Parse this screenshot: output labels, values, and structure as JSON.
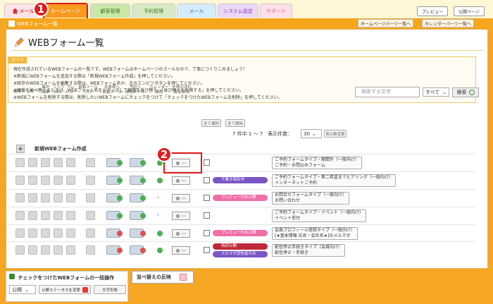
{
  "tabs": [
    {
      "label": "メール"
    },
    {
      "label": "ホームページ"
    },
    {
      "label": "顧客管理"
    },
    {
      "label": "予約管理"
    },
    {
      "label": "メール"
    },
    {
      "label": "システム設定"
    },
    {
      "label": "サポート"
    }
  ],
  "top_buttons": {
    "preview": "プレビュー",
    "public": "公開ページ"
  },
  "annotations": [
    "1",
    "2"
  ],
  "subheader": {
    "title": "WEBフォーム一覧",
    "hp_parts": "ホームページパーツ一覧へ",
    "calendar_parts": "カレンダーパーツ一覧へ"
  },
  "page_title": "WEBフォーム一覧",
  "guide": {
    "tag": "ガイド",
    "lines": [
      "現在作成されているWEBフォームの一覧です。WEBフォームはホームページのゴールなので、丁寧につくりこみましょう！",
      "※新規にWEBフォームを追加する際は「新規WEBフォーム作成」を押してください。",
      "※既存のWEBフォームを編集する際は、WEBフォーム名か、左のエンピツボタンを押してください。",
      "※順番を並べ替えるときは、WEBフォーム名をドラッグして順番を並び替え、「並び替えを反映する」を押してください。",
      "※WEBフォームを削除する際は、削除したいWEBフォームにチェックをつけて「チェックをつけたWEBフォームを削除」を押してください。"
    ]
  },
  "columns": [
    "編集",
    "コピー",
    "集計\n結果",
    "リンク\nURL",
    "プレ\nビュー",
    "自動メール\n(件)",
    "お客様へ\n自動メール",
    "当社へ\n通知メール",
    "カレンダー\n連携",
    "全体の流れ\n設定状況"
  ],
  "select_buttons": {
    "select_all": "全て選択",
    "deselect_all": "全て解除"
  },
  "search": {
    "placeholder": "検索する文字",
    "scope": "すべて",
    "button": "検索"
  },
  "pager": {
    "text": "7 件中 1 ～ 7　表示件数：",
    "per_page": "30",
    "show_button": "表示数変更"
  },
  "new_form_label": "新規WEBフォーム作成",
  "rows": [
    {
      "status": "",
      "status_color": "",
      "name_1": "ご予約フォームタイプ・期間外（一般向け）",
      "name_2": "ご予約・お問込みフォーム",
      "has_dash": false
    },
    {
      "status": "下書き保存中",
      "status_color": "#7b56c4",
      "name_1": "ご予約フォームタイプ・第二希望までヒアリング（一般向け）",
      "name_2": "インターネットご予約",
      "has_dash": false
    },
    {
      "status": "プレビューのみ公開",
      "status_color": "#f06fa7",
      "name_1": "お問合せフォームタイプ（一般向け）",
      "name_2": "お問い合わせ",
      "has_dash": true
    },
    {
      "status": "",
      "status_color": "",
      "name_1": "ご予約フォームタイプ・イベント（一般向け）",
      "name_2": "イベント受付",
      "has_dash": true
    },
    {
      "status": "プレビューのみ公開",
      "status_color": "#f06fa7",
      "name_1": "会員プロフィール登録タイプ（一般向け）",
      "name_2": "[★基本情報 氏名・会社名★]のメルマガ",
      "has_dash": false
    },
    {
      "status": "特別公開",
      "status_color": "#c0283a",
      "status_2": "メルマガ受信者のみ",
      "status_2_color": "#7b56c4",
      "name_1": "配信停止手続きタイプ（会員向け）",
      "name_2": "配信停止・手続き",
      "has_dash": false
    }
  ],
  "bulk": {
    "title": "チェックをつけたWEBフォームの一括操作",
    "status_value": "公開",
    "status_change": "公開ステータスを変更",
    "text_color": "文字形態"
  },
  "sort_button": "並べ替えの反映"
}
